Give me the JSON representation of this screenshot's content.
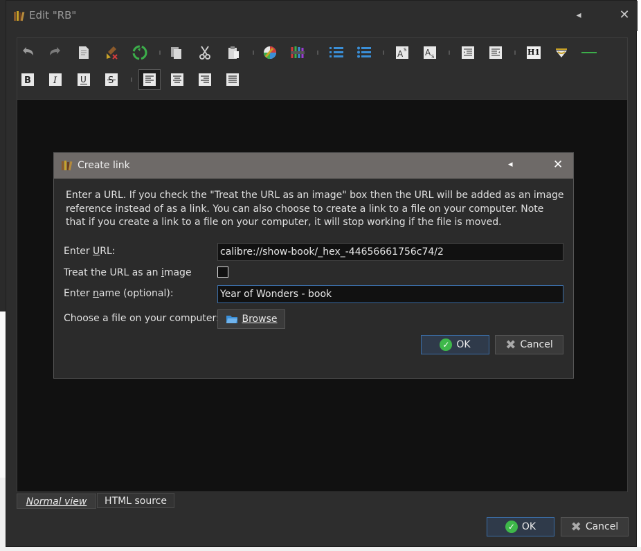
{
  "window": {
    "title": "Edit \"RB\"",
    "collapse_icon": "◂",
    "close_icon": "✕"
  },
  "toolbar": {
    "row1": [
      "undo-icon",
      "redo-icon",
      "clear-document-icon",
      "remove-format-icon",
      "recycle-icon",
      "copy-icon",
      "cut-icon",
      "paste-icon",
      "foreground-color-icon",
      "background-color-icon",
      "ordered-list-icon",
      "unordered-list-icon",
      "superscript-icon",
      "subscript-icon",
      "indent-icon",
      "outdent-icon",
      "heading-icon",
      "insert-link-icon",
      "horizontal-rule-icon"
    ],
    "row2": [
      "bold-icon",
      "italic-icon",
      "underline-icon",
      "strikethrough-icon",
      "align-left-icon",
      "align-center-icon",
      "align-right-icon",
      "justify-icon"
    ],
    "heading_glyph": "H1"
  },
  "tabs": {
    "normal_view": "Normal view",
    "html_source": "HTML source"
  },
  "footer": {
    "ok": "OK",
    "cancel": "Cancel"
  },
  "dialog": {
    "title": "Create link",
    "description": "Enter a URL. If you check the \"Treat the URL as an image\" box then the URL will be added as an image reference instead of as a link. You can also choose to create a link to a file on your computer. Note that if you create a link to a file on your computer, it will stop working if the file is moved.",
    "url_label": "Enter URL:",
    "url_value": "calibre://show-book/_hex_-44656661756c74/2",
    "image_label": "Treat the URL as an image",
    "image_checked": false,
    "name_label": "Enter name (optional):",
    "name_value": "Year of Wonders - book",
    "file_label": "Choose a file on your computer:",
    "browse": "Browse",
    "ok": "OK",
    "cancel": "Cancel"
  },
  "colors": {
    "accent": "#3b6ea8",
    "ok_green": "#3eb84a",
    "list_blue": "#3a8fd8"
  }
}
